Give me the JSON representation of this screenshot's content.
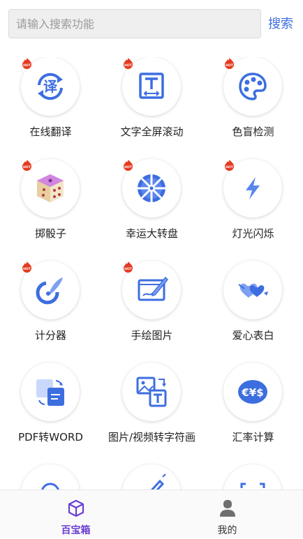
{
  "search": {
    "placeholder": "请输入搜索功能",
    "button_label": "搜索"
  },
  "colors": {
    "accent": "#3d6ee0",
    "icon_blue": "#3d6ee0",
    "hot_badge": "#e53a20",
    "active_tab": "#6a3fd0"
  },
  "tools": [
    {
      "label": "在线翻译",
      "icon": "translate-icon",
      "hot": true
    },
    {
      "label": "文字全屏滚动",
      "icon": "text-scroll-icon",
      "hot": true
    },
    {
      "label": "色盲检测",
      "icon": "palette-icon",
      "hot": true
    },
    {
      "label": "掷骰子",
      "icon": "dice-icon",
      "hot": true
    },
    {
      "label": "幸运大转盘",
      "icon": "wheel-icon",
      "hot": true
    },
    {
      "label": "灯光闪烁",
      "icon": "lightning-icon",
      "hot": true
    },
    {
      "label": "计分器",
      "icon": "scorer-icon",
      "hot": true
    },
    {
      "label": "手绘图片",
      "icon": "drawing-icon",
      "hot": true
    },
    {
      "label": "爱心表白",
      "icon": "hearts-icon",
      "hot": false
    },
    {
      "label": "PDF转WORD",
      "icon": "pdf-convert-icon",
      "hot": false
    },
    {
      "label": "图片/视频转字符画",
      "icon": "image-to-text-icon",
      "hot": false
    },
    {
      "label": "汇率计算",
      "icon": "currency-icon",
      "hot": false
    }
  ],
  "tabbar": [
    {
      "label": "百宝箱",
      "icon": "box-icon",
      "active": true
    },
    {
      "label": "我的",
      "icon": "user-icon",
      "active": false
    }
  ]
}
